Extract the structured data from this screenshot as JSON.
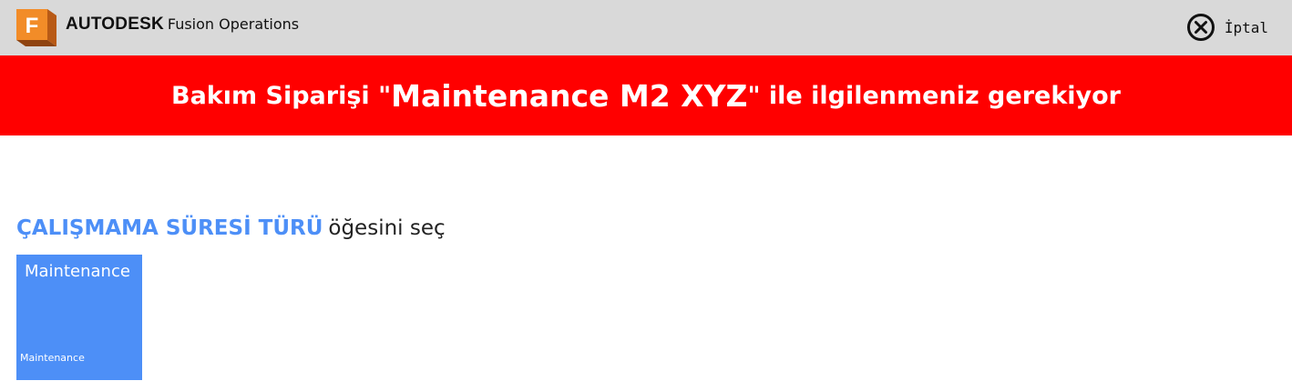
{
  "header": {
    "brand_company": "AUTODESK",
    "brand_product": "Fusion Operations",
    "logo_letter": "F",
    "logo_icon": "fusion-logo-icon",
    "cancel_icon": "close-circle-icon",
    "cancel_label": "İptal",
    "background_color": "#d9d9d9"
  },
  "banner": {
    "text_pre": "Bakım Siparişi \"",
    "order_name": "Maintenance M2 XYZ",
    "text_post": "\" ile ilgilenmeniz gerekiyor",
    "background_color": "#ff0000"
  },
  "prompt": {
    "field_name": "ÇALIŞMAMA SÜRESİ TÜRÜ",
    "rest": "öğesini seç",
    "accent_color": "#4d8ff7"
  },
  "options": [
    {
      "title": "Maintenance",
      "subtitle": "Maintenance",
      "color": "#4d8ff7"
    }
  ]
}
